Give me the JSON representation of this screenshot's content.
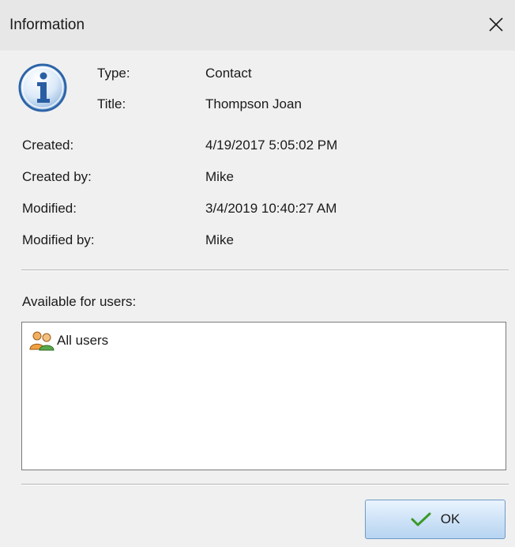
{
  "window": {
    "title": "Information"
  },
  "header": {
    "type_label": "Type:",
    "type_value": "Contact",
    "title_label": "Title:",
    "title_value": "Thompson Joan"
  },
  "details": [
    {
      "label": "Created:",
      "value": "4/19/2017 5:05:02 PM"
    },
    {
      "label": "Created by:",
      "value": "Mike"
    },
    {
      "label": "Modified:",
      "value": "3/4/2019 10:40:27 AM"
    },
    {
      "label": "Modified by:",
      "value": "Mike"
    }
  ],
  "users": {
    "label": "Available for users:",
    "items": [
      {
        "label": "All users",
        "icon": "users-group-icon"
      }
    ]
  },
  "buttons": {
    "ok_label": "OK",
    "ok_icon": "checkmark-icon"
  }
}
